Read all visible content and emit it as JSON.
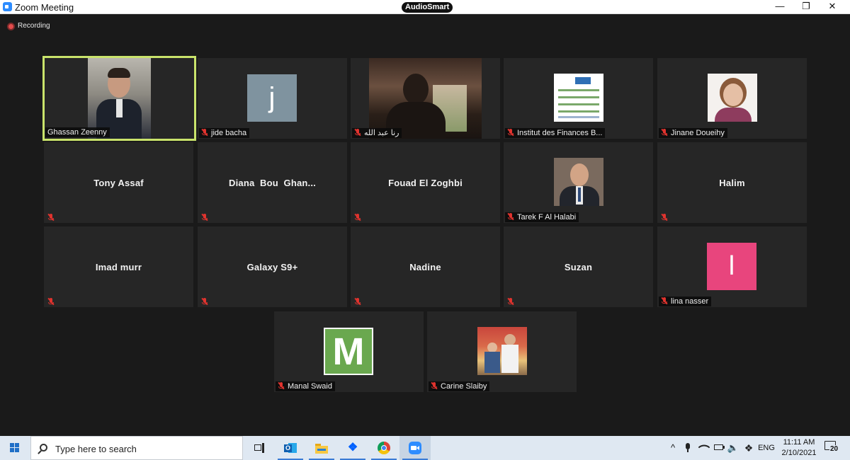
{
  "window": {
    "title": "Zoom Meeting",
    "center_badge": "AudioSmart",
    "minimize_glyph": "—",
    "maximize_glyph": "❐",
    "close_glyph": "✕"
  },
  "recording": {
    "label": "Recording"
  },
  "participants": [
    {
      "name": "Ghassan Zeenny",
      "video": true,
      "active_speaker": true,
      "muted": false
    },
    {
      "name": "jide bacha",
      "avatar_letter": "j",
      "avatar_color": "#7f939f",
      "muted": true
    },
    {
      "name": "رنا عبد الله",
      "video": true,
      "muted": true
    },
    {
      "name": "Institut des Finances B...",
      "picture": true,
      "muted": true
    },
    {
      "name": "Jinane Doueihy",
      "picture": true,
      "muted": true
    },
    {
      "name": "Tony Assaf",
      "muted": true
    },
    {
      "name": "Diana  Bou  Ghan...",
      "muted": true
    },
    {
      "name": "Fouad El Zoghbi",
      "muted": true
    },
    {
      "name": "Tarek F Al Halabi",
      "picture": true,
      "muted": true
    },
    {
      "name": "Halim",
      "muted": true
    },
    {
      "name": "Imad murr",
      "muted": true
    },
    {
      "name": "Galaxy S9+",
      "muted": true
    },
    {
      "name": "Nadine",
      "muted": true
    },
    {
      "name": "Suzan",
      "muted": true
    },
    {
      "name": "lina nasser",
      "avatar_letter": "l",
      "avatar_color": "#e8457d",
      "muted": true
    },
    {
      "name": "Manal Swaid",
      "avatar_letter": "M",
      "avatar_color": "#6aa84f",
      "muted": true
    },
    {
      "name": "Carine Slaiby",
      "picture": true,
      "muted": true
    }
  ],
  "taskbar": {
    "search_placeholder": "Type here to search",
    "apps": [
      "task-view",
      "outlook",
      "file-explorer",
      "dropbox",
      "chrome",
      "zoom"
    ],
    "language": "ENG",
    "time": "11:11 AM",
    "date": "2/10/2021",
    "notification_count": "20"
  }
}
